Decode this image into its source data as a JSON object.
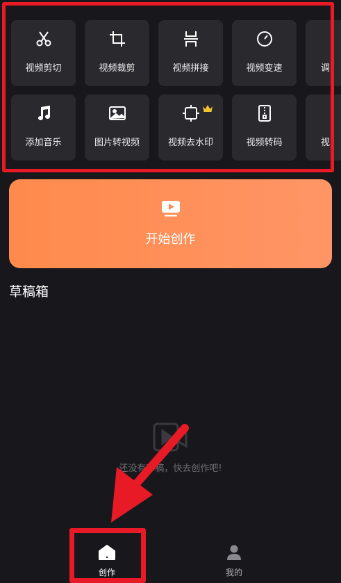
{
  "tools": [
    {
      "label": "视频剪切",
      "icon": "scissors-icon"
    },
    {
      "label": "视频裁剪",
      "icon": "crop-icon"
    },
    {
      "label": "视频拼接",
      "icon": "merge-icon"
    },
    {
      "label": "视频变速",
      "icon": "speedometer-icon"
    },
    {
      "label": "调",
      "icon": "adjust-icon"
    },
    {
      "label": "添加音乐",
      "icon": "music-note-icon"
    },
    {
      "label": "图片转视频",
      "icon": "image-icon"
    },
    {
      "label": "视频去水印",
      "icon": "watermark-remove-icon",
      "vip": true
    },
    {
      "label": "视频转码",
      "icon": "zip-file-icon"
    },
    {
      "label": "视",
      "icon": "video-icon"
    }
  ],
  "start": {
    "label": "开始创作",
    "icon": "play-screen-icon"
  },
  "drafts": {
    "title": "草稿箱",
    "empty_text": "还没有草稿，快去创作吧!",
    "empty_icon": "empty-video-icon"
  },
  "tabbar": {
    "tabs": [
      {
        "label": "创作",
        "icon": "home-icon",
        "active": true
      },
      {
        "label": "我的",
        "icon": "person-icon",
        "active": false
      }
    ]
  },
  "colors": {
    "background": "#18171c",
    "tile": "#2a292e",
    "accent": "#ff8a4c",
    "highlight": "#e81a26",
    "crown": "#f2c230"
  }
}
